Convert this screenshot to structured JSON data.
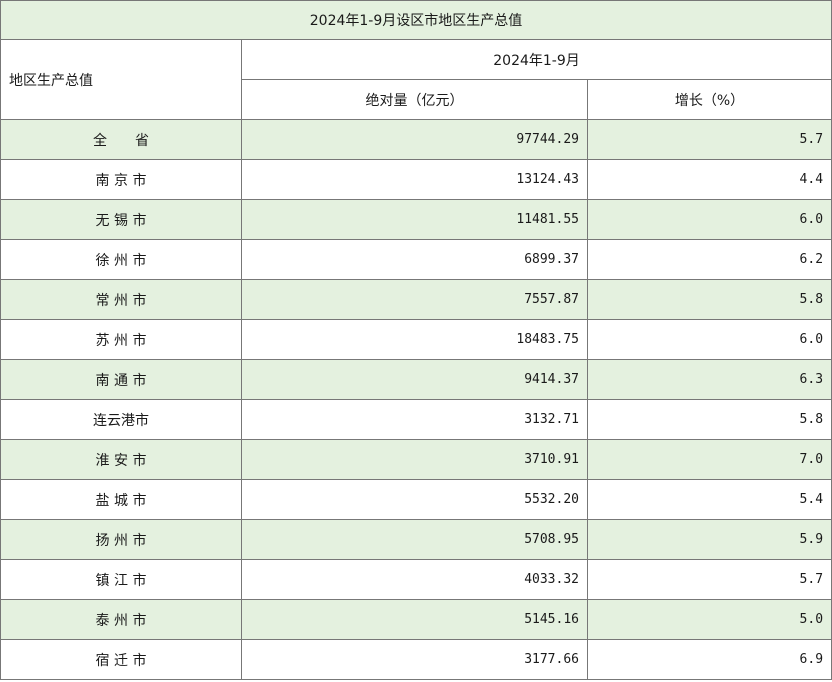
{
  "table": {
    "title": "2024年1-9月设区市地区生产总值",
    "row_header": "地区生产总值",
    "period": "2024年1-9月",
    "col_value": "绝对量（亿元）",
    "col_growth": "增长（%）",
    "rows": [
      {
        "region": "全　　省",
        "value": "97744.29",
        "growth": "5.7"
      },
      {
        "region": "南 京 市",
        "value": "13124.43",
        "growth": "4.4"
      },
      {
        "region": "无 锡 市",
        "value": "11481.55",
        "growth": "6.0"
      },
      {
        "region": "徐 州 市",
        "value": "6899.37",
        "growth": "6.2"
      },
      {
        "region": "常 州 市",
        "value": "7557.87",
        "growth": "5.8"
      },
      {
        "region": "苏 州 市",
        "value": "18483.75",
        "growth": "6.0"
      },
      {
        "region": "南 通 市",
        "value": "9414.37",
        "growth": "6.3"
      },
      {
        "region": "连云港市",
        "value": "3132.71",
        "growth": "5.8"
      },
      {
        "region": "淮 安 市",
        "value": "3710.91",
        "growth": "7.0"
      },
      {
        "region": "盐 城 市",
        "value": "5532.20",
        "growth": "5.4"
      },
      {
        "region": "扬 州 市",
        "value": "5708.95",
        "growth": "5.9"
      },
      {
        "region": "镇 江 市",
        "value": "4033.32",
        "growth": "5.7"
      },
      {
        "region": "泰 州 市",
        "value": "5145.16",
        "growth": "5.0"
      },
      {
        "region": "宿 迁 市",
        "value": "3177.66",
        "growth": "6.9"
      }
    ]
  },
  "colors": {
    "shade": "#e4f1df",
    "border": "#777777"
  }
}
